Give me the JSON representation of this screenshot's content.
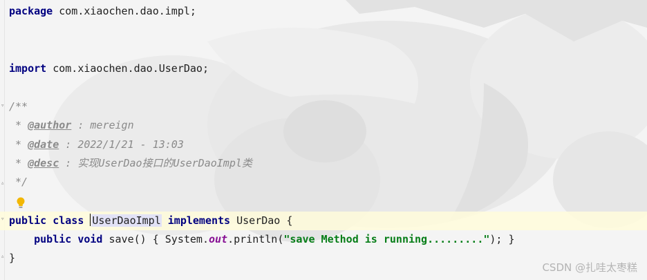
{
  "code": {
    "package_kw": "package",
    "package_name": " com.xiaochen.dao.impl;",
    "import_kw": "import",
    "import_name": " com.xiaochen.dao.UserDao;",
    "doc_open": "/**",
    "author_prefix": " * ",
    "author_tag": "@author",
    "author_text": " : mereign",
    "date_prefix": " * ",
    "date_tag": "@date",
    "date_text": " : 2022/1/21 - 13:03",
    "desc_prefix": " * ",
    "desc_tag": "@desc",
    "desc_text": " : 实现UserDao接口的UserDaoImpl类",
    "doc_close": " */",
    "public_kw": "public",
    "class_kw": "class",
    "class_name": "UserDaoImpl",
    "implements_kw": "implements",
    "interface_part": " UserDao {",
    "method_indent": "    ",
    "method_public_kw": "public",
    "void_kw": "void",
    "method_sig": " save() { System.",
    "out_field": "out",
    "println_part": ".println(",
    "string_literal": "\"save Method is running.........\"",
    "method_close": "); }",
    "class_close": "}"
  },
  "watermark": "CSDN @扎哇太枣糕",
  "icons": [
    "lightbulb-icon",
    "fold-icon"
  ],
  "colors": {
    "keyword": "#000080",
    "string": "#067d17",
    "comment": "#8a8a8a",
    "static_field": "#871094",
    "caret_row": "#fffcda"
  }
}
